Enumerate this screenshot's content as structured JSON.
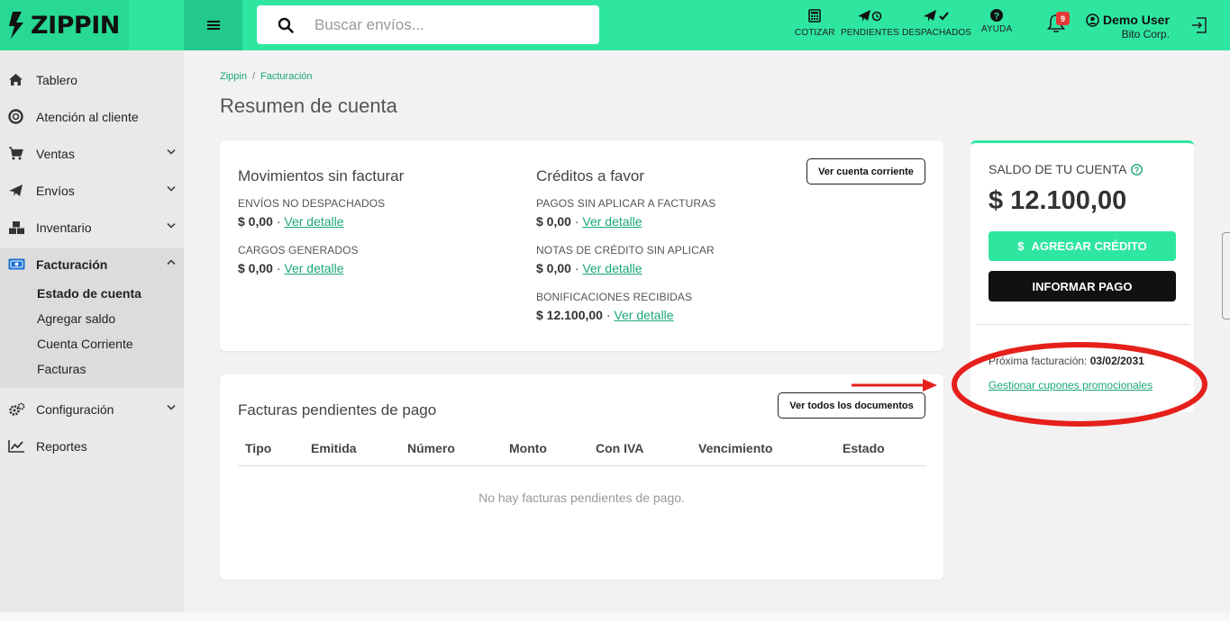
{
  "brand": {
    "name": "ZIPPIN"
  },
  "search": {
    "placeholder": "Buscar envíos..."
  },
  "top_actions": [
    {
      "label": "COTIZAR",
      "icon": "calculator-icon"
    },
    {
      "label": "PENDIENTES",
      "icon": "plane-clock-icon"
    },
    {
      "label": "DESPACHADOS",
      "icon": "plane-check-icon"
    },
    {
      "label": "AYUDA",
      "icon": "help-icon"
    }
  ],
  "notifications": {
    "count": "9"
  },
  "user": {
    "name": "Demo User",
    "company": "Bito Corp."
  },
  "sidebar": {
    "items": [
      {
        "label": "Tablero",
        "icon": "home-icon"
      },
      {
        "label": "Atención al cliente",
        "icon": "lifebuoy-icon"
      },
      {
        "label": "Ventas",
        "icon": "cart-icon"
      },
      {
        "label": "Envíos",
        "icon": "plane-icon"
      },
      {
        "label": "Inventario",
        "icon": "boxes-icon"
      },
      {
        "label": "Facturación",
        "icon": "money-icon"
      },
      {
        "label": "Configuración",
        "icon": "cogs-icon"
      },
      {
        "label": "Reportes",
        "icon": "chart-icon"
      }
    ],
    "facturacion_sub": [
      {
        "label": "Estado de cuenta"
      },
      {
        "label": "Agregar saldo"
      },
      {
        "label": "Cuenta Corriente"
      },
      {
        "label": "Facturas"
      }
    ]
  },
  "breadcrumb": {
    "root": "Zippin",
    "separator": "/",
    "current": "Facturación"
  },
  "page": {
    "title": "Resumen de cuenta"
  },
  "movimientos": {
    "title": "Movimientos sin facturar",
    "rows": [
      {
        "caption": "ENVÍOS NO DESPACHADOS",
        "amount": "$ 0,00",
        "link": "Ver detalle"
      },
      {
        "caption": "CARGOS GENERADOS",
        "amount": "$ 0,00",
        "link": "Ver detalle"
      }
    ]
  },
  "creditos": {
    "title": "Créditos a favor",
    "button": "Ver cuenta corriente",
    "rows": [
      {
        "caption": "PAGOS SIN APLICAR A FACTURAS",
        "amount": "$ 0,00",
        "link": "Ver detalle"
      },
      {
        "caption": "NOTAS DE CRÉDITO SIN APLICAR",
        "amount": "$ 0,00",
        "link": "Ver detalle"
      },
      {
        "caption": "BONIFICACIONES RECIBIDAS",
        "amount": "$ 12.100,00",
        "link": "Ver detalle"
      }
    ]
  },
  "facturas": {
    "title": "Facturas pendientes de pago",
    "button": "Ver todos los documentos",
    "columns": [
      "Tipo",
      "Emitida",
      "Número",
      "Monto",
      "Con IVA",
      "Vencimiento",
      "Estado"
    ],
    "empty": "No hay facturas pendientes de pago."
  },
  "saldo": {
    "label": "SALDO DE TU CUENTA",
    "value": "$ 12.100,00",
    "add_credit": "AGREGAR CRÉDITO",
    "add_credit_prefix": "$",
    "inform_payment": "INFORMAR PAGO",
    "next_billing_label": "Próxima facturación:",
    "next_billing_date": "03/02/2031",
    "coupons_link": "Gestionar cupones promocionales"
  },
  "colors": {
    "accent": "#2ee6a0",
    "link": "#1aa67a",
    "annotation": "#e5201b"
  }
}
